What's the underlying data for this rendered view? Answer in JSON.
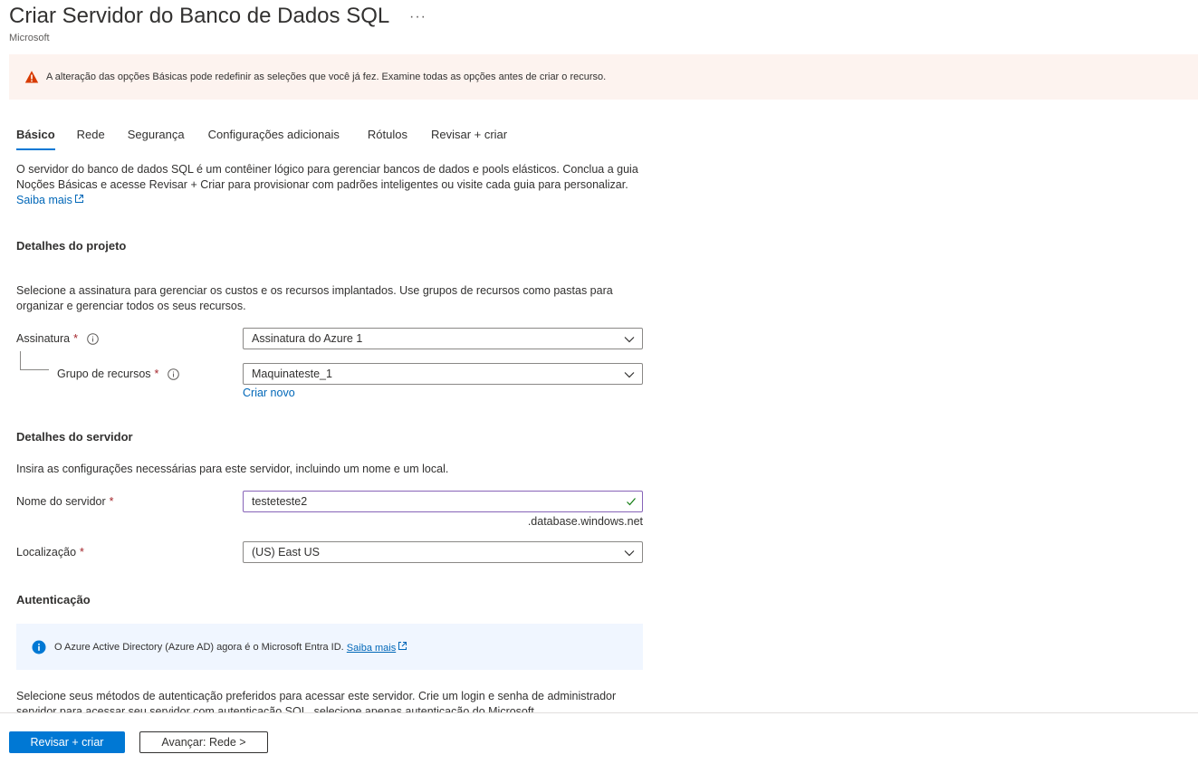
{
  "header": {
    "title": "Criar Servidor do Banco de Dados SQL",
    "more_label": "···",
    "publisher": "Microsoft"
  },
  "warning": {
    "icon": "warning-icon",
    "text": "A alteração das opções Básicas pode redefinir as seleções que você já fez. Examine todas as opções antes de criar o recurso."
  },
  "tabs": [
    {
      "label": "Básico",
      "active": true
    },
    {
      "label": "Rede",
      "active": false
    },
    {
      "label": "Segurança",
      "active": false
    },
    {
      "label": "Configurações adicionais",
      "active": false
    },
    {
      "label": "Rótulos",
      "active": false
    },
    {
      "label": "Revisar + criar",
      "active": false
    }
  ],
  "intro": {
    "text": "O servidor do banco de dados SQL é um contêiner lógico para gerenciar bancos de dados e pools elásticos. Conclua a guia Noções Básicas e acesse Revisar + Criar para provisionar com padrões inteligentes ou visite cada guia para personalizar.",
    "learn_more": "Saiba mais"
  },
  "project_details": {
    "heading": "Detalhes do projeto",
    "description": "Selecione a assinatura para gerenciar os custos e os recursos implantados. Use grupos de recursos como pastas para organizar e gerenciar todos os seus recursos.",
    "subscription_label": "Assinatura",
    "subscription_value": "Assinatura do Azure 1",
    "resource_group_label": "Grupo de recursos",
    "resource_group_value": "Maquinateste_1",
    "create_new": "Criar novo"
  },
  "server_details": {
    "heading": "Detalhes do servidor",
    "description": "Insira as configurações necessárias para este servidor, incluindo um nome e um local.",
    "server_name_label": "Nome do servidor",
    "server_name_value": "testeteste2",
    "server_suffix": ".database.windows.net",
    "location_label": "Localização",
    "location_value": "(US) East US"
  },
  "authentication": {
    "heading": "Autenticação",
    "info_text": "O Azure Active Directory (Azure AD) agora é o Microsoft Entra ID.",
    "info_link": "Saiba mais",
    "description": "Selecione seus métodos de autenticação preferidos para acessar este servidor. Crie um login e senha de administrador servidor para acessar seu servidor com autenticação SQL, selecione apenas autenticação do Microsoft"
  },
  "required_marker": "*",
  "footer": {
    "review_create": "Revisar + criar",
    "next": "Avançar: Rede >"
  },
  "colors": {
    "accent": "#0078d4",
    "link": "#0067b8",
    "warning_bg": "#fdf3ef",
    "info_bg": "#f0f6ff",
    "required": "#a4262c",
    "valid_border": "#8764b8",
    "valid_check": "#107c10"
  }
}
